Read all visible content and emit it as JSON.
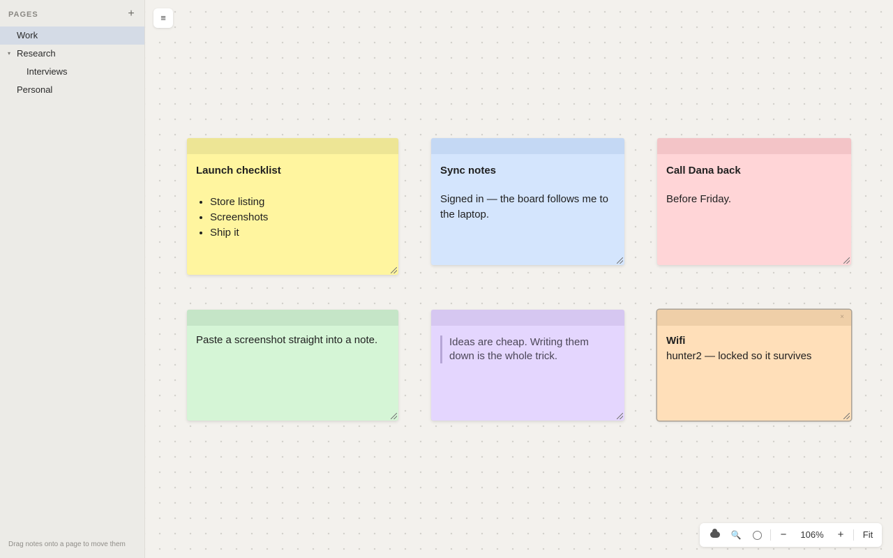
{
  "sidebar": {
    "title": "PAGES",
    "add_label": "+",
    "items": [
      {
        "label": "Work",
        "active": true
      },
      {
        "label": "Research",
        "expanded": true
      },
      {
        "label": "Interviews"
      },
      {
        "label": "Personal"
      }
    ],
    "caret": "▾",
    "footer": "Drag notes onto a page to move them"
  },
  "canvas": {
    "menu_label": "≡",
    "notes": [
      {
        "color": "yellow",
        "title": "Launch checklist",
        "items": [
          "Store listing",
          "Screenshots",
          "Ship it"
        ]
      },
      {
        "color": "blue",
        "title": "Sync notes",
        "text": "Signed in — the board follows me to the laptop."
      },
      {
        "color": "pink",
        "title": "Call Dana back",
        "text": "Before Friday."
      },
      {
        "color": "green",
        "text": "Paste a screenshot straight into a note."
      },
      {
        "color": "purple",
        "quote": "Ideas are cheap. Writing them down is the whole trick."
      },
      {
        "color": "orange",
        "locked": true,
        "title": "Wifi",
        "text": "hunter2 — locked so it survives",
        "close": "×"
      }
    ]
  },
  "toolbar": {
    "zoom": "106%",
    "zoom_out": "−",
    "zoom_in": "+",
    "fit": "Fit",
    "search_glyph": "🔍"
  }
}
